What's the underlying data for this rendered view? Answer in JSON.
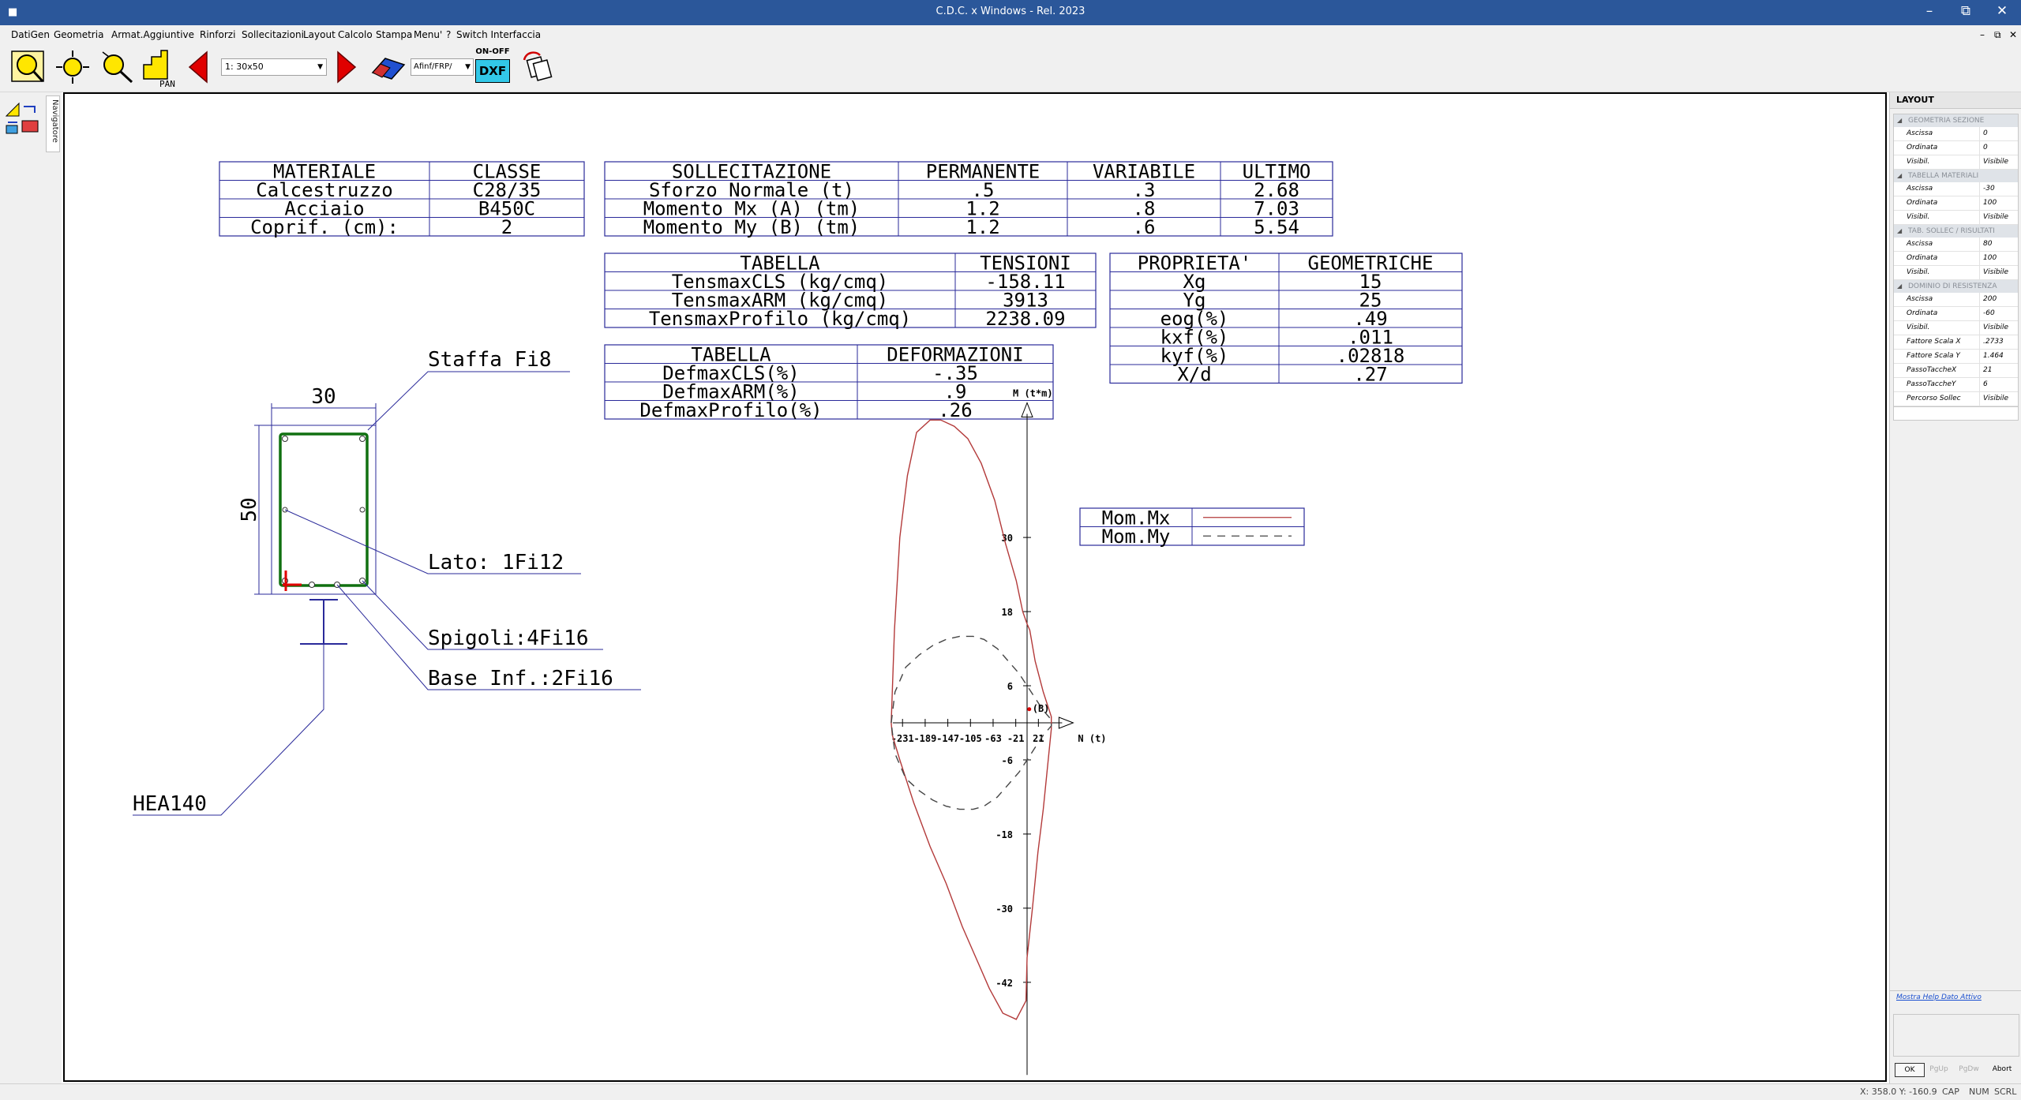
{
  "window": {
    "title": "C.D.C. x Windows - Rel. 2023"
  },
  "menu": [
    "DatiGen",
    "Geometria",
    "Armat.Aggiuntive",
    "Rinforzi",
    "Sollecitazioni",
    "Layout",
    "Calcolo",
    "Stampa",
    "Menu'",
    "?",
    "Switch Interfaccia"
  ],
  "toolbar": {
    "pan_label": "PAN",
    "section_select": "1: 30x50",
    "reinf_select": "Afinf/FRP/",
    "onoff_label": "ON-OFF",
    "dxf_label": "DXF"
  },
  "navigator_tab": "Navigatore",
  "tables": {
    "materiali": {
      "headers": [
        "MATERIALE",
        "CLASSE"
      ],
      "rows": [
        [
          "Calcestruzzo",
          "C28/35"
        ],
        [
          "Acciaio",
          "B450C"
        ],
        [
          "Coprif. (cm):",
          "2"
        ]
      ]
    },
    "sollecitazioni": {
      "headers": [
        "SOLLECITAZIONE",
        "PERMANENTE",
        "VARIABILE",
        "ULTIMO"
      ],
      "rows": [
        [
          "Sforzo Normale (t)",
          ".5",
          ".3",
          "2.68"
        ],
        [
          "Momento Mx (A) (tm)",
          "1.2",
          ".8",
          "7.03"
        ],
        [
          "Momento My (B) (tm)",
          "1.2",
          ".6",
          "5.54"
        ]
      ]
    },
    "tensioni": {
      "headers": [
        "TABELLA",
        "TENSIONI"
      ],
      "rows": [
        [
          "TensmaxCLS (kg/cmq)",
          "-158.11"
        ],
        [
          "TensmaxARM (kg/cmq)",
          "3913"
        ],
        [
          "TensmaxProfilo (kg/cmq)",
          "2238.09"
        ]
      ]
    },
    "deformazioni": {
      "headers": [
        "TABELLA",
        "DEFORMAZIONI"
      ],
      "rows": [
        [
          "DefmaxCLS(%)",
          "-.35"
        ],
        [
          "DefmaxARM(%)",
          ".9"
        ],
        [
          "DefmaxProfilo(%)",
          ".26"
        ]
      ]
    },
    "proprieta": {
      "headers": [
        "PROPRIETA'",
        "GEOMETRICHE"
      ],
      "rows": [
        [
          "Xg",
          "15"
        ],
        [
          "Yg",
          "25"
        ],
        [
          "eog(%)",
          ".49"
        ],
        [
          "kxf(%)",
          ".011"
        ],
        [
          "kyf(%)",
          ".02818"
        ],
        [
          "X/d",
          ".27"
        ]
      ]
    }
  },
  "section": {
    "width_label": "30",
    "height_label": "50",
    "staffa": "Staffa Fi8",
    "lato": "Lato: 1Fi12",
    "spigoli": "Spigoli:4Fi16",
    "base": "Base Inf.:2Fi16",
    "profile": "HEA140",
    "colors": {
      "stirrup": "#107010",
      "leader": "#2a2a9a",
      "origin": "#e00000"
    }
  },
  "chart_data": {
    "type": "line",
    "xlabel": "N (t)",
    "ylabel": "M (t*m)",
    "x_ticks": [
      -231,
      -189,
      -147,
      -105,
      -63,
      -21,
      21
    ],
    "y_ticks": [
      -42,
      -30,
      -18,
      -6,
      6,
      18,
      30
    ],
    "xlim": [
      -249,
      65
    ],
    "ylim": [
      -57,
      50
    ],
    "point_label": "(B)",
    "point": [
      4.0,
      2.2
    ],
    "series": [
      {
        "name": "Mom.Mx",
        "style": "solid",
        "color": "#b33a3a",
        "x": [
          -252,
          -246,
          -236,
          -222,
          -205,
          -180,
          -160,
          -135,
          -110,
          -85,
          -60,
          -40,
          -20,
          -8,
          0,
          5,
          15,
          30,
          45,
          45,
          38,
          30,
          20,
          10,
          0,
          -2,
          -20,
          -45,
          -70,
          -95,
          -120,
          -150,
          -180,
          -210,
          -236,
          -250,
          -252
        ],
        "y": [
          0,
          15,
          30,
          40,
          47,
          49,
          49,
          48,
          46,
          42,
          36,
          29,
          23,
          18,
          16,
          15,
          10,
          5,
          1,
          -1,
          -7,
          -14,
          -21,
          -30,
          -38,
          -45,
          -48,
          -47,
          -43,
          -38,
          -33,
          -26,
          -20,
          -13,
          -6,
          -2,
          0
        ]
      },
      {
        "name": "Mom.My",
        "style": "dashed",
        "color": "#444444",
        "x": [
          -252,
          -245,
          -235,
          -225,
          -200,
          -175,
          -150,
          -125,
          -100,
          -80,
          -55,
          -35,
          -15,
          0,
          15,
          30,
          45,
          45,
          30,
          15,
          0,
          -15,
          -35,
          -55,
          -80,
          -100,
          -125,
          -150,
          -175,
          -200,
          -225,
          -235,
          -245,
          -252
        ],
        "y": [
          0,
          5,
          7,
          9,
          11,
          12.5,
          13.5,
          14,
          14,
          13.5,
          12,
          10,
          8,
          6,
          4,
          2,
          0.5,
          -0.5,
          -2,
          -4,
          -6,
          -8,
          -10,
          -12,
          -13.5,
          -14,
          -14,
          -13.5,
          -12.5,
          -11,
          -9,
          -7,
          -5,
          0
        ]
      }
    ],
    "legend": [
      "Mom.Mx",
      "Mom.My"
    ]
  },
  "panel": {
    "title": "LAYOUT",
    "groups": [
      {
        "name": "GEOMETRIA SEZIONE",
        "rows": [
          [
            "Ascissa",
            "0"
          ],
          [
            "Ordinata",
            "0"
          ],
          [
            "Visibil.",
            "Visibile"
          ]
        ]
      },
      {
        "name": "TABELLA MATERIALI",
        "rows": [
          [
            "Ascissa",
            "-30"
          ],
          [
            "Ordinata",
            "100"
          ],
          [
            "Visibil.",
            "Visibile"
          ]
        ]
      },
      {
        "name": "TAB. SOLLEC / RISULTATI",
        "rows": [
          [
            "Ascissa",
            "80"
          ],
          [
            "Ordinata",
            "100"
          ],
          [
            "Visibil.",
            "Visibile"
          ]
        ]
      },
      {
        "name": "DOMINIO DI RESISTENZA",
        "rows": [
          [
            "Ascissa",
            "200"
          ],
          [
            "Ordinata",
            "-60"
          ],
          [
            "Visibil.",
            "Visibile"
          ],
          [
            "Fattore Scala X",
            ".2733"
          ],
          [
            "Fattore Scala Y",
            "1.464"
          ],
          [
            "PassoTaccheX",
            "21"
          ],
          [
            "PassoTaccheY",
            "6"
          ],
          [
            "Percorso Sollec",
            "Visibile"
          ]
        ]
      }
    ],
    "help_link": "Mostra Help Dato Attivo",
    "buttons": [
      "OK",
      "PgUp",
      "PgDw",
      "Abort"
    ]
  },
  "status": {
    "coords": "X: 358.0  Y: -160.9",
    "cap": "CAP",
    "num": "NUM",
    "scrl": "SCRL"
  }
}
